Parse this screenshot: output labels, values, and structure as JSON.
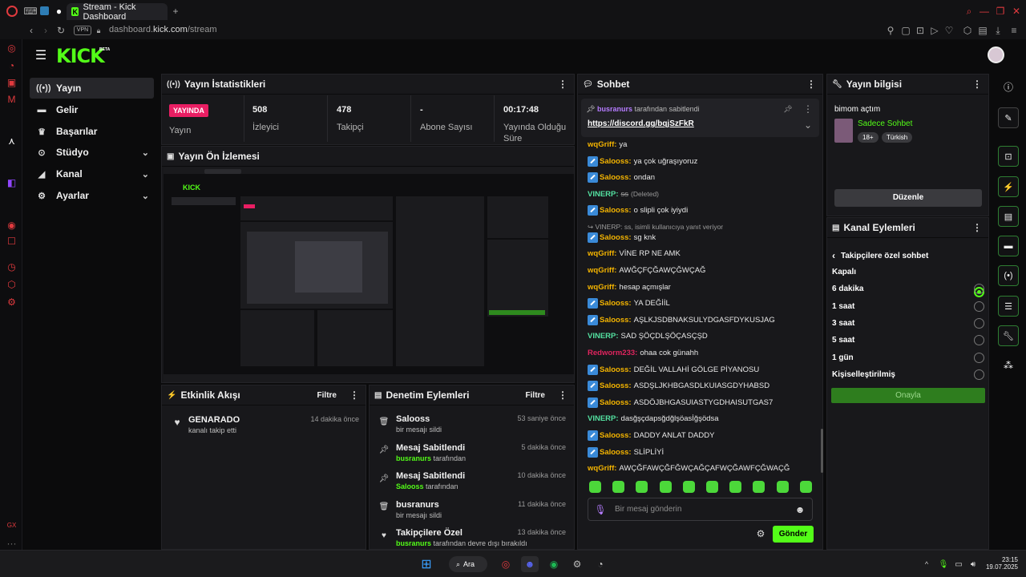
{
  "browser": {
    "tab_title": "Stream - Kick Dashboard",
    "url_domain": "dashboard.",
    "url_host": "kick.com",
    "url_path": "/stream",
    "vpn": "VPN"
  },
  "app": {
    "logo": "KICK",
    "logo_beta": "BETA"
  },
  "sidebar": {
    "items": [
      {
        "label": "Yayın",
        "icon": "broadcast-icon"
      },
      {
        "label": "Gelir",
        "icon": "money-icon"
      },
      {
        "label": "Başarılar",
        "icon": "trophy-icon"
      },
      {
        "label": "Stüdyo",
        "icon": "studio-icon"
      },
      {
        "label": "Kanal",
        "icon": "channel-icon"
      },
      {
        "label": "Ayarlar",
        "icon": "gear-icon"
      }
    ]
  },
  "stats": {
    "title": "Yayın İstatistikleri",
    "live_badge": "YAYINDA",
    "live_label": "Yayın",
    "viewers": "508",
    "viewers_label": "İzleyici",
    "followers": "478",
    "followers_label": "Takipçi",
    "subs": "-",
    "subs_label": "Abone Sayısı",
    "duration": "00:17:48",
    "duration_label1": "Yayında Olduğu",
    "duration_label2": "Süre"
  },
  "preview": {
    "title": "Yayın Ön İzlemesi"
  },
  "activity": {
    "title": "Etkinlik Akışı",
    "filter": "Filtre",
    "items": [
      {
        "user": "GENARADO",
        "text": "kanalı takip etti",
        "time": "14 dakika önce"
      }
    ]
  },
  "moderation": {
    "title": "Denetim Eylemleri",
    "filter": "Filtre",
    "items": [
      {
        "title": "Salooss",
        "sub": "bir mesajı sildi",
        "sub_user": "",
        "time": "53 saniye önce",
        "icon": "trash-icon"
      },
      {
        "title": "Mesaj Sabitlendi",
        "sub": "tarafından",
        "sub_user": "busranurs",
        "time": "5 dakika önce",
        "icon": "pin-icon"
      },
      {
        "title": "Mesaj Sabitlendi",
        "sub": "tarafından",
        "sub_user": "Salooss",
        "time": "10 dakika önce",
        "icon": "pin-icon"
      },
      {
        "title": "busranurs",
        "sub": "bir mesajı sildi",
        "sub_user": "",
        "time": "11 dakika önce",
        "icon": "trash-icon"
      },
      {
        "title": "Takipçilere Özel",
        "sub": "tarafından devre dışı bırakıldı",
        "sub_user": "busranurs",
        "time": "13 dakika önce",
        "icon": "heart-icon"
      }
    ]
  },
  "chat": {
    "title": "Sohbet",
    "pinned_by": "busranurs",
    "pinned_suffix": "tarafından sabitlendi",
    "pinned_link": "https://discord.gg/bqjSzFkR",
    "messages": [
      {
        "user": "wqGriff",
        "color": "#f4b400",
        "text": "ya",
        "badge": false
      },
      {
        "user": "Salooss",
        "color": "#f4b400",
        "text": "ya çok uğraşıyoruz",
        "badge": true
      },
      {
        "user": "Salooss",
        "color": "#f4b400",
        "text": "ondan",
        "badge": true
      },
      {
        "user": "VINERP",
        "color": "#53e0a0",
        "text": "ss",
        "badge": false,
        "deleted": "(Deleted)"
      },
      {
        "user": "Salooss",
        "color": "#f4b400",
        "text": "o slipli çok iyiydi",
        "badge": true
      },
      {
        "user": "",
        "color": "#9a9a9a",
        "text": "VINERP: ss, isimli kullanıcıya yanıt veriyor",
        "badge": false,
        "reply": true
      },
      {
        "user": "Salooss",
        "color": "#f4b400",
        "text": "sg knk",
        "badge": true
      },
      {
        "user": "wqGriff",
        "color": "#f4b400",
        "text": "VİNE RP NE AMK",
        "badge": false
      },
      {
        "user": "wqGriff",
        "color": "#f4b400",
        "text": "AWĞÇFÇĞAWÇĞWÇAĞ",
        "badge": false
      },
      {
        "user": "wqGriff",
        "color": "#f4b400",
        "text": "hesap açmışlar",
        "badge": false
      },
      {
        "user": "Salooss",
        "color": "#f4b400",
        "text": "YA DEĞİİL",
        "badge": true
      },
      {
        "user": "Salooss",
        "color": "#f4b400",
        "text": "AŞLKJSDBNAKSULYDGASFDYKUSJAG",
        "badge": true
      },
      {
        "user": "VINERP",
        "color": "#53e0a0",
        "text": "SAD ŞÖÇDLŞÖÇASÇŞD",
        "badge": false
      },
      {
        "user": "Redworm233",
        "color": "#e0245e",
        "text": "ohaa cok günahh",
        "badge": false
      },
      {
        "user": "Salooss",
        "color": "#f4b400",
        "text": "DEĞİL VALLAHİ GÖLGE PİYANOSU",
        "badge": true
      },
      {
        "user": "Salooss",
        "color": "#f4b400",
        "text": "ASDŞLJKHBGASDLKUIASGDYHABSD",
        "badge": true
      },
      {
        "user": "Salooss",
        "color": "#f4b400",
        "text": "ASDÖJBHGASUIASTYGDHAISUTGAS7",
        "badge": true
      },
      {
        "user": "VINERP",
        "color": "#53e0a0",
        "text": "dasğşçdapsğdğlşöasİğşödsa",
        "badge": false
      },
      {
        "user": "Salooss",
        "color": "#f4b400",
        "text": "DADDY ANLAT DADDY",
        "badge": true
      },
      {
        "user": "Salooss",
        "color": "#f4b400",
        "text": "SLİPLİYİ",
        "badge": true
      },
      {
        "user": "wqGriff",
        "color": "#f4b400",
        "text": "AWÇĞFAWÇĞFĞWÇAĞÇAFWÇĞAWFÇĞWAÇĞ",
        "badge": false
      }
    ],
    "input_placeholder": "Bir mesaj gönderin",
    "send": "Gönder"
  },
  "stream_info": {
    "title": "Yayın bilgisi",
    "stream_title": "bimom açtım",
    "category": "Sadece Sohbet",
    "tag1": "18+",
    "tag2": "Türkish",
    "edit": "Düzenle"
  },
  "channel_actions": {
    "title": "Kanal Eylemleri",
    "sub_title": "Takipçilere özel sohbet",
    "options": [
      "Kapalı",
      "6 dakika",
      "1 saat",
      "3 saat",
      "5 saat",
      "1 gün",
      "Kişiselleştirilmiş"
    ],
    "selected": 0,
    "confirm": "Onayla"
  },
  "taskbar": {
    "search": "Ara",
    "time": "23:15",
    "date": "19.07.2025"
  },
  "colors": {
    "accent": "#53fc18",
    "live": "#e91e63"
  }
}
